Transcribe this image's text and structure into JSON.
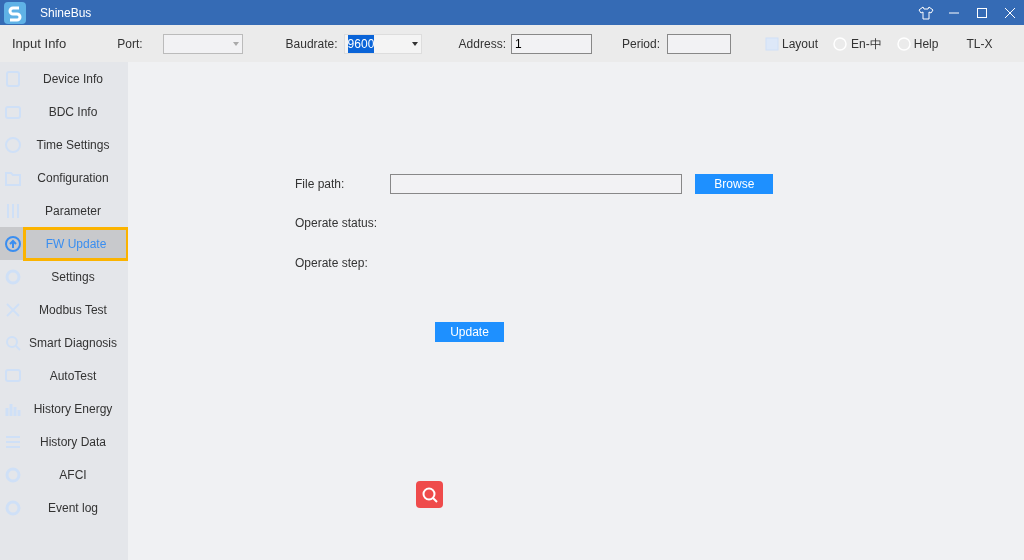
{
  "window": {
    "title": "ShineBus"
  },
  "toolbar": {
    "section": "Input Info",
    "port_label": "Port:",
    "baudrate_label": "Baudrate:",
    "baudrate_value": "9600",
    "address_label": "Address:",
    "address_value": "1",
    "period_label": "Period:",
    "layout": "Layout",
    "language": "En-中",
    "help": "Help",
    "model": "TL-X"
  },
  "sidebar": {
    "items": [
      {
        "label": "Device Info",
        "selected": false
      },
      {
        "label": "BDC Info",
        "selected": false
      },
      {
        "label": "Time Settings",
        "selected": false
      },
      {
        "label": "Configuration",
        "selected": false
      },
      {
        "label": "Parameter",
        "selected": false
      },
      {
        "label": "FW Update",
        "selected": true
      },
      {
        "label": "Settings",
        "selected": false
      },
      {
        "label": "Modbus Test",
        "selected": false
      },
      {
        "label": "Smart Diagnosis",
        "selected": false
      },
      {
        "label": "AutoTest",
        "selected": false
      },
      {
        "label": "History Energy",
        "selected": false
      },
      {
        "label": "History Data",
        "selected": false
      },
      {
        "label": "AFCI",
        "selected": false
      },
      {
        "label": "Event log",
        "selected": false
      }
    ]
  },
  "form": {
    "file_path_label": "File path:",
    "browse": "Browse",
    "status_label": "Operate status:",
    "step_label": "Operate step:",
    "update": "Update"
  }
}
